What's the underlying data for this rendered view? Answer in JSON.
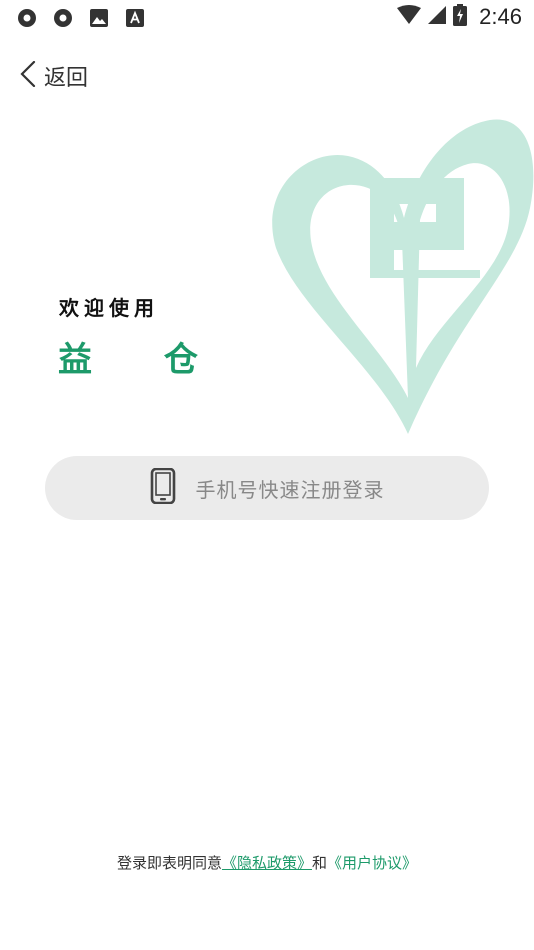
{
  "status_bar": {
    "time": "2:46",
    "left_icons": [
      "record-icon",
      "record-icon",
      "image-icon",
      "font-icon"
    ],
    "right_icons": [
      "wifi-icon",
      "signal-icon",
      "battery-charging-icon"
    ]
  },
  "nav": {
    "back_label": "返回"
  },
  "welcome": {
    "line1": "欢迎使用",
    "brand": "益 仓"
  },
  "login": {
    "button_label": "手机号快速注册登录",
    "icon": "phone-icon"
  },
  "agreement": {
    "prefix": "登录即表明同意",
    "privacy_link": "《隐私政策》",
    "and": "和",
    "terms_link": "《用户协议》"
  },
  "colors": {
    "brand_green": "#1d9a6a",
    "logo_mint": "#c6e9dd",
    "button_bg": "#ebebeb"
  }
}
